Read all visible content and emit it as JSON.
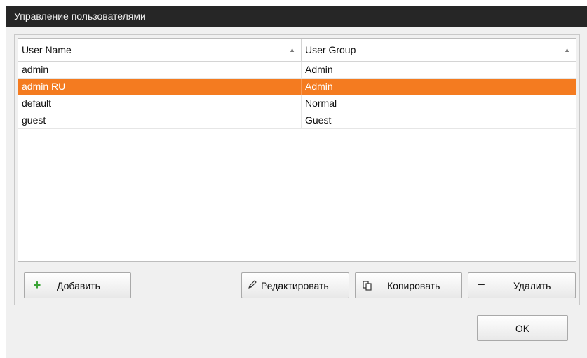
{
  "window": {
    "title": "Управление пользователями"
  },
  "table": {
    "columns": [
      {
        "label": "User Name",
        "sort": "ascending"
      },
      {
        "label": "User Group",
        "sort": "ascending"
      }
    ],
    "rows": [
      {
        "name": "admin",
        "group": "Admin",
        "selected": false
      },
      {
        "name": "admin RU",
        "group": "Admin",
        "selected": true
      },
      {
        "name": "default",
        "group": "Normal",
        "selected": false
      },
      {
        "name": "guest",
        "group": "Guest",
        "selected": false
      }
    ],
    "selection_color": "#f47b20"
  },
  "buttons": {
    "add": {
      "label": "Добавить",
      "icon": "plus-icon",
      "icon_color": "#3aa335"
    },
    "edit": {
      "label": "Редактировать",
      "icon": "pencil-icon"
    },
    "copy": {
      "label": "Копировать",
      "icon": "copy-icon"
    },
    "delete": {
      "label": "Удалить",
      "icon": "minus-icon"
    },
    "ok": {
      "label": "OK"
    }
  }
}
